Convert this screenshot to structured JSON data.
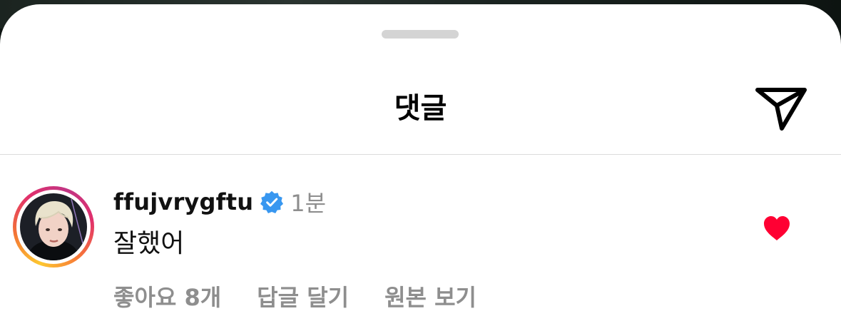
{
  "header": {
    "title": "댓글",
    "share_icon": "paper-plane-icon"
  },
  "comment": {
    "username": "ffujvrygftu",
    "verified_icon": "verified-badge-icon",
    "time": "1분",
    "text": "잘했어",
    "likes_label": "좋아요 8개",
    "reply_label": "답글 달기",
    "view_original_label": "원본 보기",
    "heart_icon": "heart-filled-icon",
    "colors": {
      "heart": "#ff0033",
      "verified": "#3897f0"
    }
  }
}
